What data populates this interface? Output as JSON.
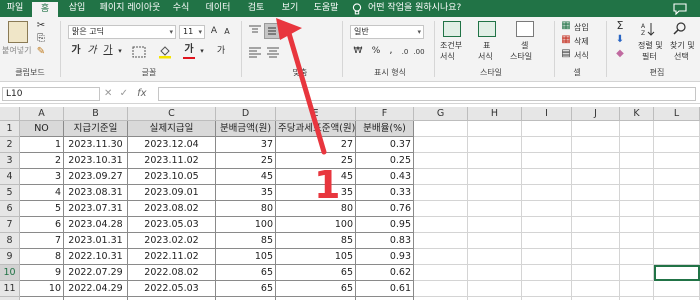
{
  "ribbon_tabs": [
    "파일",
    "홈",
    "삽입",
    "페이지 레이아웃",
    "수식",
    "데이터",
    "검토",
    "보기",
    "도움말"
  ],
  "active_tab": "홈",
  "search_placeholder": "어떤 작업을 원하시나요?",
  "clipboard": {
    "paste_label": "붙여넣기",
    "group_label": "클립보드"
  },
  "font": {
    "name": "맑은 고딕",
    "size": "11",
    "group_label": "글꼴"
  },
  "alignment": {
    "group_label": "맞춤"
  },
  "number": {
    "format": "일반",
    "group_label": "표시 형식"
  },
  "styles": {
    "conditional_label": "조건부",
    "conditional_sub": "서식",
    "table_label": "표",
    "table_sub": "서식",
    "cell_style_label": "셀",
    "cell_style_sub": "스타일",
    "group_label": "스타일"
  },
  "cells": {
    "insert": "삽입",
    "delete": "삭제",
    "format": "서식",
    "group_label": "셀"
  },
  "editing": {
    "sort_label": "정렬 및",
    "sort_sub": "필터",
    "find_label": "찾기 및",
    "find_sub": "선택",
    "group_label": "편집"
  },
  "formula_bar": {
    "name_box": "L10",
    "fx": "fx",
    "value": ""
  },
  "columns": [
    "A",
    "B",
    "C",
    "D",
    "E",
    "F",
    "G",
    "H",
    "I",
    "J",
    "K",
    "L"
  ],
  "row_numbers": [
    "1",
    "2",
    "3",
    "4",
    "5",
    "6",
    "7",
    "8",
    "9",
    "10",
    "11",
    "12"
  ],
  "selected_cell": "L10",
  "table_headers": [
    "NO",
    "지급기준일",
    "실제지급일",
    "분배금액(원)",
    "주당과세표준액(원)",
    "분배율(%)"
  ],
  "table_rows": [
    [
      "1",
      "2023.11.30",
      "2023.12.04",
      "37",
      "27",
      "0.37"
    ],
    [
      "2",
      "2023.10.31",
      "2023.11.02",
      "25",
      "25",
      "0.25"
    ],
    [
      "3",
      "2023.09.27",
      "2023.10.05",
      "45",
      "45",
      "0.43"
    ],
    [
      "4",
      "2023.08.31",
      "2023.09.01",
      "35",
      "35",
      "0.33"
    ],
    [
      "5",
      "2023.07.31",
      "2023.08.02",
      "80",
      "80",
      "0.76"
    ],
    [
      "6",
      "2023.04.28",
      "2023.05.03",
      "100",
      "100",
      "0.95"
    ],
    [
      "7",
      "2023.01.31",
      "2023.02.02",
      "85",
      "85",
      "0.83"
    ],
    [
      "8",
      "2022.10.31",
      "2022.11.02",
      "105",
      "105",
      "0.93"
    ],
    [
      "9",
      "2022.07.29",
      "2022.08.02",
      "65",
      "65",
      "0.62"
    ],
    [
      "10",
      "2022.04.29",
      "2022.05.03",
      "65",
      "65",
      "0.61"
    ],
    [
      "11",
      "2022.01.28",
      "2022.02.04",
      "55",
      "55",
      "0.54"
    ]
  ],
  "annotation": {
    "number": "1",
    "color": "#e8363e"
  },
  "colors": {
    "excel_green": "#217346",
    "ribbon_bg": "#f3f3f3",
    "header_fill": "#d9d9d9",
    "annotation_red": "#e8363e"
  }
}
